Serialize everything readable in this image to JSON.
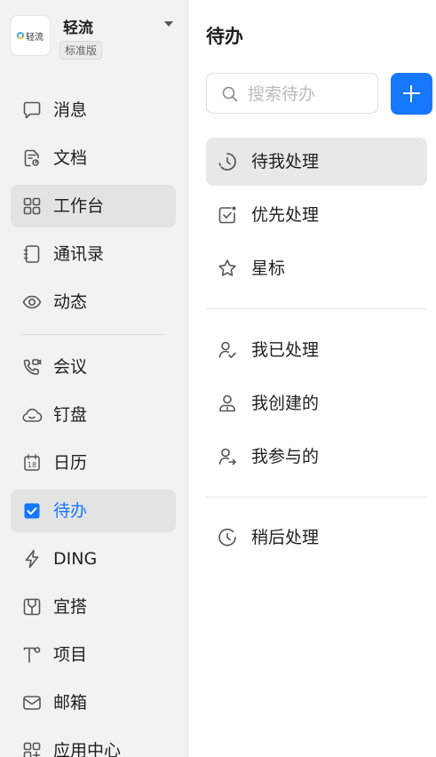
{
  "org": {
    "logo_text": "轻流",
    "name": "轻流",
    "edition": "标准版"
  },
  "sidebar": {
    "items": [
      {
        "label": "消息",
        "icon": "message-icon"
      },
      {
        "label": "文档",
        "icon": "document-icon"
      },
      {
        "label": "工作台",
        "icon": "workbench-icon",
        "state": "selected"
      },
      {
        "label": "通讯录",
        "icon": "contacts-icon"
      },
      {
        "label": "动态",
        "icon": "eye-icon"
      },
      {
        "label": "会议",
        "icon": "video-call-icon"
      },
      {
        "label": "钉盘",
        "icon": "cloud-drive-icon"
      },
      {
        "label": "日历",
        "icon": "calendar-icon",
        "calendar_day": "18"
      },
      {
        "label": "待办",
        "icon": "checkbox-icon",
        "state": "active"
      },
      {
        "label": "DING",
        "icon": "lightning-icon"
      },
      {
        "label": "宜搭",
        "icon": "yida-icon"
      },
      {
        "label": "项目",
        "icon": "project-icon"
      },
      {
        "label": "邮箱",
        "icon": "mail-icon"
      },
      {
        "label": "应用中心",
        "icon": "app-center-icon"
      }
    ]
  },
  "main": {
    "title": "待办",
    "search": {
      "placeholder": "搜索待办",
      "value": ""
    },
    "add_button": {
      "icon": "plus-icon"
    },
    "groups": [
      [
        {
          "label": "待我处理",
          "icon": "pending-clock-icon",
          "state": "selected"
        },
        {
          "label": "优先处理",
          "icon": "priority-check-icon"
        },
        {
          "label": "星标",
          "icon": "star-icon"
        }
      ],
      [
        {
          "label": "我已处理",
          "icon": "user-check-icon"
        },
        {
          "label": "我创建的",
          "icon": "user-created-icon"
        },
        {
          "label": "我参与的",
          "icon": "user-share-icon"
        }
      ],
      [
        {
          "label": "稍后处理",
          "icon": "later-clock-icon"
        }
      ]
    ]
  },
  "colors": {
    "accent": "#1677ff",
    "sidebar_bg": "#f2f2f2",
    "selected_bg": "#e3e3e3",
    "text": "#1f1f1f",
    "icon": "#555555"
  }
}
